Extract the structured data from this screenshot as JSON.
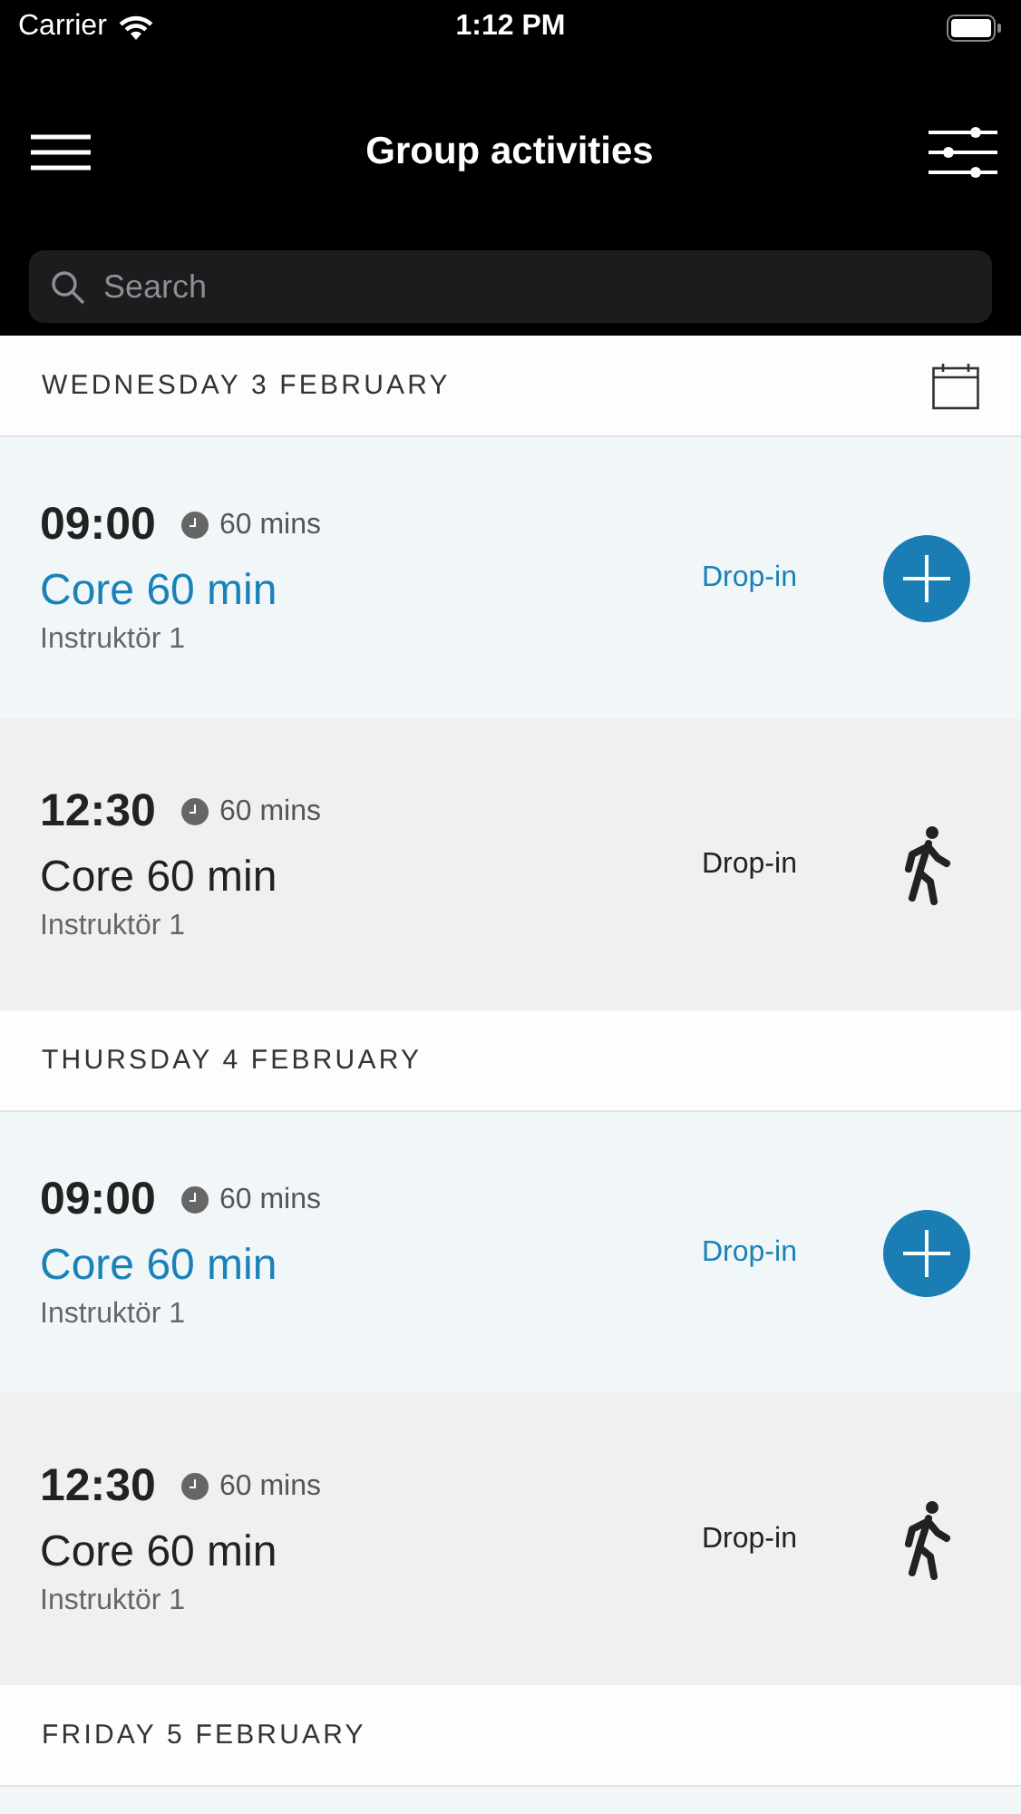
{
  "status_bar": {
    "carrier": "Carrier",
    "time": "1:12 PM"
  },
  "nav": {
    "title": "Group activities"
  },
  "search": {
    "placeholder": "Search"
  },
  "days": [
    {
      "label": "WEDNESDAY 3 FEBRUARY",
      "calendar": true,
      "activities": [
        {
          "kind": "bookable",
          "time": "09:00",
          "duration": "60 mins",
          "name": "Core 60 min",
          "instructor": "Instruktör 1",
          "type": "Drop-in"
        },
        {
          "kind": "walk_in",
          "time": "12:30",
          "duration": "60 mins",
          "name": "Core 60 min",
          "instructor": "Instruktör 1",
          "type": "Drop-in"
        }
      ]
    },
    {
      "label": "THURSDAY 4 FEBRUARY",
      "calendar": false,
      "activities": [
        {
          "kind": "bookable",
          "time": "09:00",
          "duration": "60 mins",
          "name": "Core 60 min",
          "instructor": "Instruktör 1",
          "type": "Drop-in"
        },
        {
          "kind": "walk_in",
          "time": "12:30",
          "duration": "60 mins",
          "name": "Core 60 min",
          "instructor": "Instruktör 1",
          "type": "Drop-in"
        }
      ]
    },
    {
      "label": "FRIDAY 5 FEBRUARY",
      "calendar": false
    }
  ]
}
